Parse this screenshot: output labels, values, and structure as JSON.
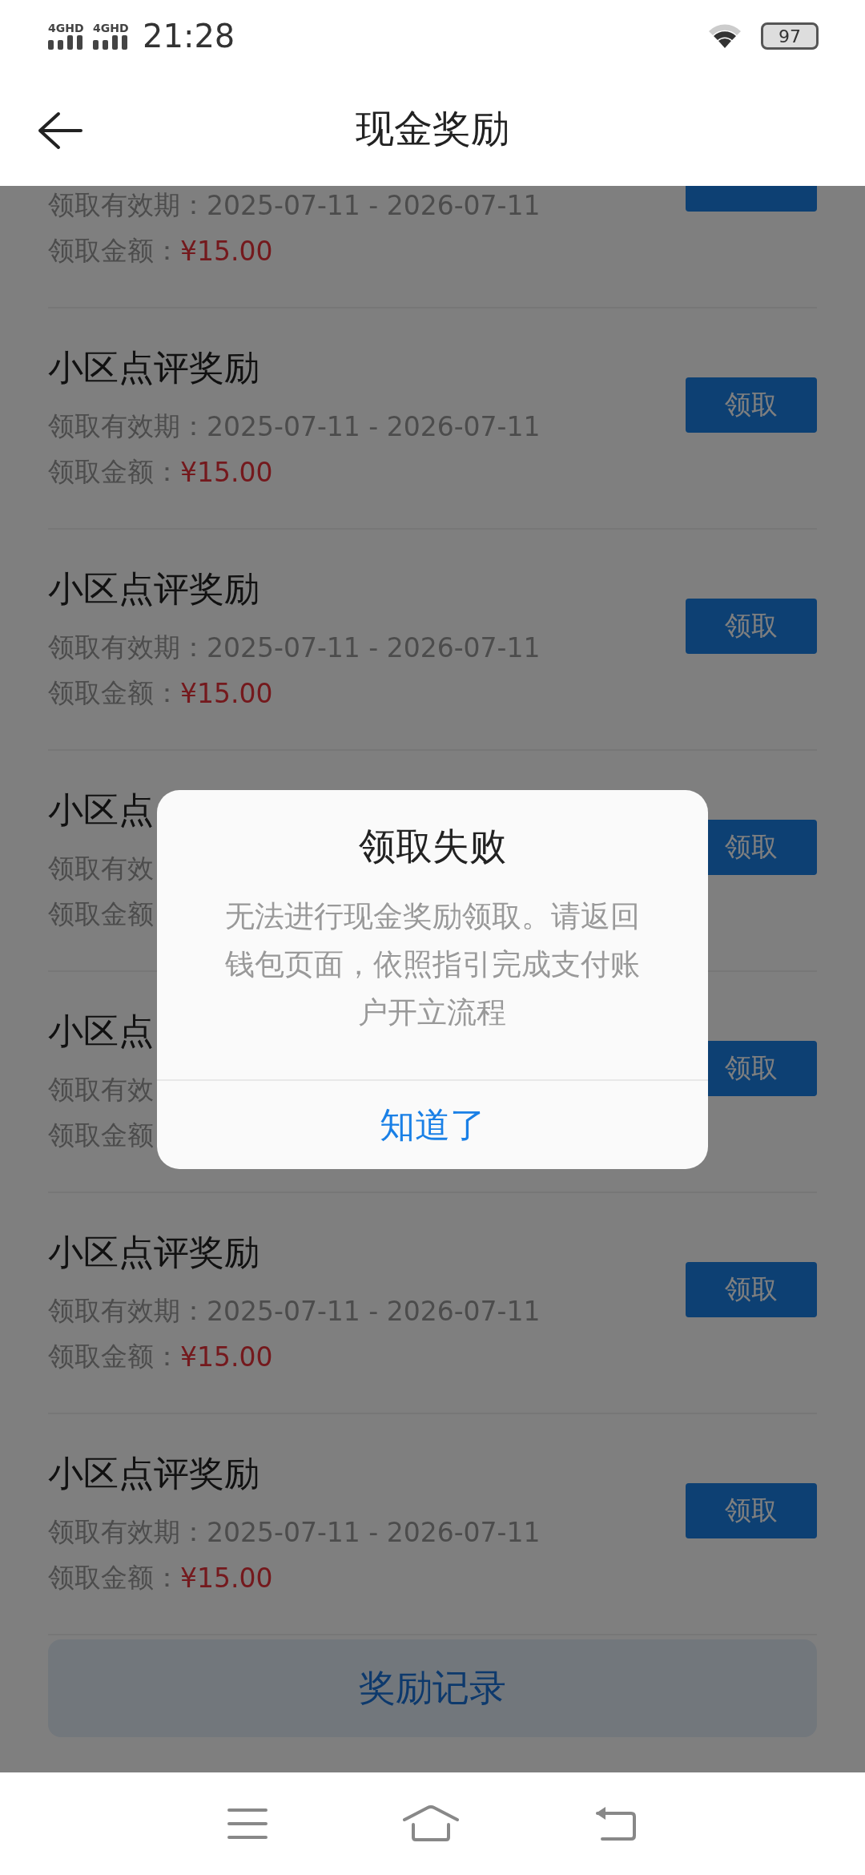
{
  "status_bar": {
    "signals": [
      "4GHD",
      "4GHD"
    ],
    "time": "21:28",
    "battery": "97"
  },
  "header": {
    "title": "现金奖励"
  },
  "rewards": [
    {
      "validity_label": "领取有效期：",
      "validity": "2025-07-11 - 2026-07-11",
      "amount_label": "领取金额：",
      "amount": "¥15.00"
    },
    {
      "title": "小区点评奖励",
      "validity_label": "领取有效期：",
      "validity": "2025-07-11 - 2026-07-11",
      "amount_label": "领取金额：",
      "amount": "¥15.00",
      "button": "领取"
    },
    {
      "title": "小区点评奖励",
      "validity_label": "领取有效期：",
      "validity": "2025-07-11 - 2026-07-11",
      "amount_label": "领取金额：",
      "amount": "¥15.00",
      "button": "领取"
    },
    {
      "title": "小区点",
      "validity_label": "领取有效",
      "amount_label": "领取金额",
      "button": "领取"
    },
    {
      "title": "小区点",
      "validity_label": "领取有效",
      "amount_label": "领取金额",
      "button": "领取"
    },
    {
      "title": "小区点评奖励",
      "validity_label": "领取有效期：",
      "validity": "2025-07-11 - 2026-07-11",
      "amount_label": "领取金额：",
      "amount": "¥15.00",
      "button": "领取"
    },
    {
      "title": "小区点评奖励",
      "validity_label": "领取有效期：",
      "validity": "2025-07-11 - 2026-07-11",
      "amount_label": "领取金额：",
      "amount": "¥15.00",
      "button": "领取"
    }
  ],
  "records_button": "奖励记录",
  "dialog": {
    "title": "领取失败",
    "message": "无法进行现金奖励领取。请返回钱包页面，依照指引完成支付账户开立流程",
    "button": "知道了"
  }
}
